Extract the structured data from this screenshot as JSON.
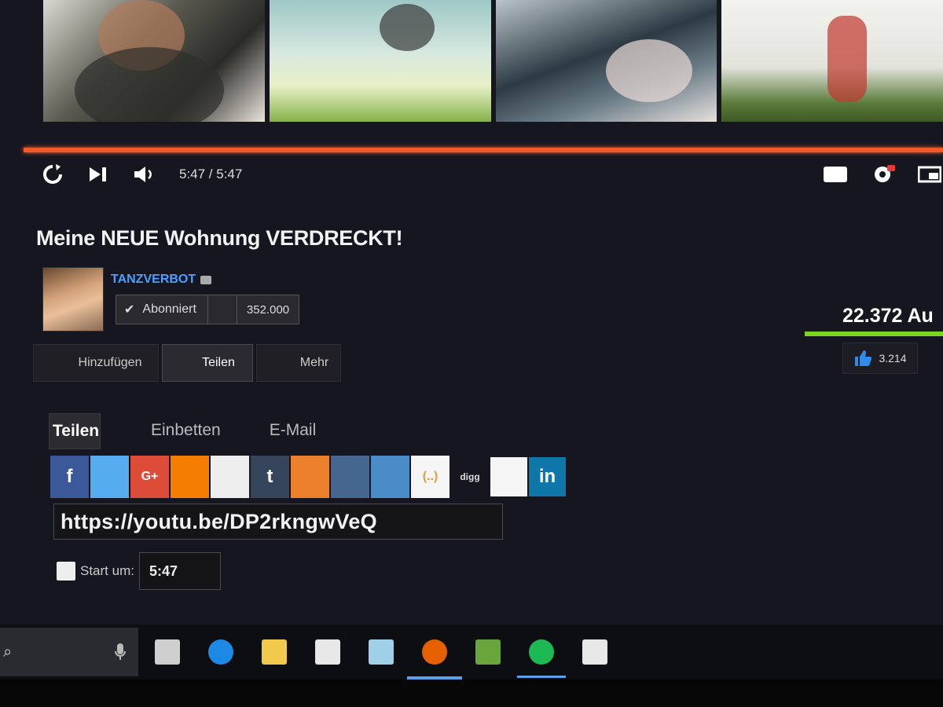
{
  "player": {
    "time_display": "5:47 / 5:47",
    "progress_fraction": 1.0,
    "controls": [
      "replay-icon",
      "next-icon",
      "volume-icon"
    ],
    "right_controls": [
      "subtitles-icon",
      "settings-icon",
      "miniplayer-icon"
    ]
  },
  "video": {
    "title": "Meine NEUE Wohnung VERDRECKT!",
    "views": "22.372 Au",
    "likes": "3.214"
  },
  "channel": {
    "name": "TANZVERBOT",
    "subscribe_label": "Abonniert",
    "subscriber_count": "352.000"
  },
  "actions": {
    "add_label": "Hinzufügen",
    "share_label": "Teilen",
    "more_label": "Mehr"
  },
  "share": {
    "tabs": {
      "share": "Teilen",
      "embed": "Einbetten",
      "email": "E-Mail"
    },
    "services": [
      {
        "name": "facebook",
        "glyph": "f",
        "color": "#3b5998"
      },
      {
        "name": "twitter",
        "glyph": "",
        "color": "#55acee"
      },
      {
        "name": "google-plus",
        "glyph": "G+",
        "color": "#dd4b39"
      },
      {
        "name": "blogger",
        "glyph": "",
        "color": "#f57d00"
      },
      {
        "name": "reddit",
        "glyph": "",
        "color": "#eeeeee"
      },
      {
        "name": "tumblr",
        "glyph": "t",
        "color": "#35465c"
      },
      {
        "name": "odnoklassniki",
        "glyph": "",
        "color": "#ed812b"
      },
      {
        "name": "vk",
        "glyph": "",
        "color": "#45668e"
      },
      {
        "name": "pinterest",
        "glyph": "",
        "color": "#4a8cc8"
      },
      {
        "name": "kakao",
        "glyph": "(..)",
        "color": "#f5f5f5"
      },
      {
        "name": "digg",
        "glyph": "digg",
        "color": "transparent"
      },
      {
        "name": "stumbleupon",
        "glyph": "",
        "color": "#f5f5f5"
      },
      {
        "name": "linkedin",
        "glyph": "in",
        "color": "#0e76a8"
      }
    ],
    "url": "https://youtu.be/DP2rkngwVeQ",
    "start_label": "Start um:",
    "start_value": "5:47"
  },
  "taskbar": {
    "apps": [
      {
        "name": "task-view-icon",
        "color": "#cfcfcf"
      },
      {
        "name": "edge-icon",
        "color": "#1e88e5"
      },
      {
        "name": "file-explorer-icon",
        "color": "#f3c94b"
      },
      {
        "name": "store-icon",
        "color": "#e8e8e8"
      },
      {
        "name": "photos-icon",
        "color": "#9fd0e8"
      },
      {
        "name": "firefox-icon",
        "color": "#e66000"
      },
      {
        "name": "minecraft-icon",
        "color": "#6aa53b"
      },
      {
        "name": "spotify-icon",
        "color": "#1db954"
      },
      {
        "name": "mail-icon",
        "color": "#e8e8e8"
      }
    ]
  }
}
